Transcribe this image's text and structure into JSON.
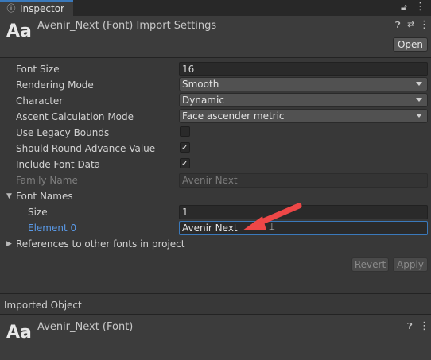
{
  "tab": {
    "icon": "info-icon",
    "label": "Inspector"
  },
  "header": {
    "icon_text": "Aa",
    "title": "Avenir_Next (Font) Import Settings",
    "open_label": "Open"
  },
  "properties": {
    "font_size": {
      "label": "Font Size",
      "value": "16"
    },
    "rendering_mode": {
      "label": "Rendering Mode",
      "value": "Smooth"
    },
    "character": {
      "label": "Character",
      "value": "Dynamic"
    },
    "ascent": {
      "label": "Ascent Calculation Mode",
      "value": "Face ascender metric"
    },
    "legacy_bounds": {
      "label": "Use Legacy Bounds",
      "checked": false
    },
    "round_advance": {
      "label": "Should Round Advance Value",
      "checked": true,
      "mark": "✓"
    },
    "include_font_data": {
      "label": "Include Font Data",
      "checked": true,
      "mark": "✓"
    },
    "family_name": {
      "label": "Family Name",
      "value": "Avenir Next"
    },
    "font_names": {
      "label": "Font Names",
      "expanded": true
    },
    "size": {
      "label": "Size",
      "value": "1"
    },
    "element0": {
      "label": "Element 0",
      "value": "Avenir Next"
    },
    "references": {
      "label": "References to other fonts in project",
      "expanded": false
    }
  },
  "buttons": {
    "revert": "Revert",
    "apply": "Apply"
  },
  "imported_object": {
    "section_label": "Imported Object",
    "icon_text": "Aa",
    "title": "Avenir_Next (Font)"
  },
  "colors": {
    "annotation_arrow": "#ee4747",
    "focus_border": "#3a79bb",
    "accent_label": "#5a9ae8"
  }
}
